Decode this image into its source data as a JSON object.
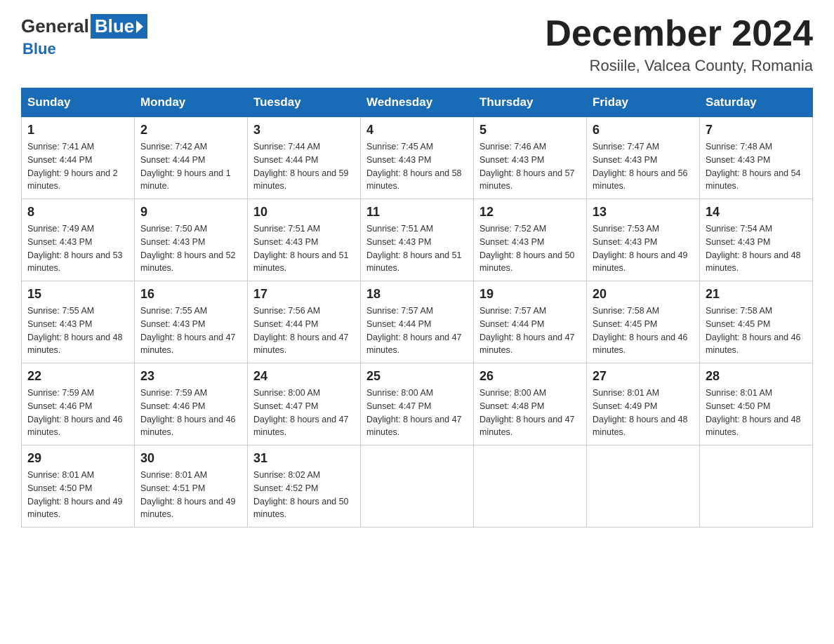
{
  "logo": {
    "general": "General",
    "blue": "Blue",
    "subtitle": "Blue"
  },
  "header": {
    "title": "December 2024",
    "subtitle": "Rosiile, Valcea County, Romania"
  },
  "weekdays": [
    "Sunday",
    "Monday",
    "Tuesday",
    "Wednesday",
    "Thursday",
    "Friday",
    "Saturday"
  ],
  "weeks": [
    [
      {
        "day": "1",
        "sunrise": "7:41 AM",
        "sunset": "4:44 PM",
        "daylight": "9 hours and 2 minutes."
      },
      {
        "day": "2",
        "sunrise": "7:42 AM",
        "sunset": "4:44 PM",
        "daylight": "9 hours and 1 minute."
      },
      {
        "day": "3",
        "sunrise": "7:44 AM",
        "sunset": "4:44 PM",
        "daylight": "8 hours and 59 minutes."
      },
      {
        "day": "4",
        "sunrise": "7:45 AM",
        "sunset": "4:43 PM",
        "daylight": "8 hours and 58 minutes."
      },
      {
        "day": "5",
        "sunrise": "7:46 AM",
        "sunset": "4:43 PM",
        "daylight": "8 hours and 57 minutes."
      },
      {
        "day": "6",
        "sunrise": "7:47 AM",
        "sunset": "4:43 PM",
        "daylight": "8 hours and 56 minutes."
      },
      {
        "day": "7",
        "sunrise": "7:48 AM",
        "sunset": "4:43 PM",
        "daylight": "8 hours and 54 minutes."
      }
    ],
    [
      {
        "day": "8",
        "sunrise": "7:49 AM",
        "sunset": "4:43 PM",
        "daylight": "8 hours and 53 minutes."
      },
      {
        "day": "9",
        "sunrise": "7:50 AM",
        "sunset": "4:43 PM",
        "daylight": "8 hours and 52 minutes."
      },
      {
        "day": "10",
        "sunrise": "7:51 AM",
        "sunset": "4:43 PM",
        "daylight": "8 hours and 51 minutes."
      },
      {
        "day": "11",
        "sunrise": "7:51 AM",
        "sunset": "4:43 PM",
        "daylight": "8 hours and 51 minutes."
      },
      {
        "day": "12",
        "sunrise": "7:52 AM",
        "sunset": "4:43 PM",
        "daylight": "8 hours and 50 minutes."
      },
      {
        "day": "13",
        "sunrise": "7:53 AM",
        "sunset": "4:43 PM",
        "daylight": "8 hours and 49 minutes."
      },
      {
        "day": "14",
        "sunrise": "7:54 AM",
        "sunset": "4:43 PM",
        "daylight": "8 hours and 48 minutes."
      }
    ],
    [
      {
        "day": "15",
        "sunrise": "7:55 AM",
        "sunset": "4:43 PM",
        "daylight": "8 hours and 48 minutes."
      },
      {
        "day": "16",
        "sunrise": "7:55 AM",
        "sunset": "4:43 PM",
        "daylight": "8 hours and 47 minutes."
      },
      {
        "day": "17",
        "sunrise": "7:56 AM",
        "sunset": "4:44 PM",
        "daylight": "8 hours and 47 minutes."
      },
      {
        "day": "18",
        "sunrise": "7:57 AM",
        "sunset": "4:44 PM",
        "daylight": "8 hours and 47 minutes."
      },
      {
        "day": "19",
        "sunrise": "7:57 AM",
        "sunset": "4:44 PM",
        "daylight": "8 hours and 47 minutes."
      },
      {
        "day": "20",
        "sunrise": "7:58 AM",
        "sunset": "4:45 PM",
        "daylight": "8 hours and 46 minutes."
      },
      {
        "day": "21",
        "sunrise": "7:58 AM",
        "sunset": "4:45 PM",
        "daylight": "8 hours and 46 minutes."
      }
    ],
    [
      {
        "day": "22",
        "sunrise": "7:59 AM",
        "sunset": "4:46 PM",
        "daylight": "8 hours and 46 minutes."
      },
      {
        "day": "23",
        "sunrise": "7:59 AM",
        "sunset": "4:46 PM",
        "daylight": "8 hours and 46 minutes."
      },
      {
        "day": "24",
        "sunrise": "8:00 AM",
        "sunset": "4:47 PM",
        "daylight": "8 hours and 47 minutes."
      },
      {
        "day": "25",
        "sunrise": "8:00 AM",
        "sunset": "4:47 PM",
        "daylight": "8 hours and 47 minutes."
      },
      {
        "day": "26",
        "sunrise": "8:00 AM",
        "sunset": "4:48 PM",
        "daylight": "8 hours and 47 minutes."
      },
      {
        "day": "27",
        "sunrise": "8:01 AM",
        "sunset": "4:49 PM",
        "daylight": "8 hours and 48 minutes."
      },
      {
        "day": "28",
        "sunrise": "8:01 AM",
        "sunset": "4:50 PM",
        "daylight": "8 hours and 48 minutes."
      }
    ],
    [
      {
        "day": "29",
        "sunrise": "8:01 AM",
        "sunset": "4:50 PM",
        "daylight": "8 hours and 49 minutes."
      },
      {
        "day": "30",
        "sunrise": "8:01 AM",
        "sunset": "4:51 PM",
        "daylight": "8 hours and 49 minutes."
      },
      {
        "day": "31",
        "sunrise": "8:02 AM",
        "sunset": "4:52 PM",
        "daylight": "8 hours and 50 minutes."
      },
      null,
      null,
      null,
      null
    ]
  ],
  "labels": {
    "sunrise": "Sunrise:",
    "sunset": "Sunset:",
    "daylight": "Daylight:"
  }
}
